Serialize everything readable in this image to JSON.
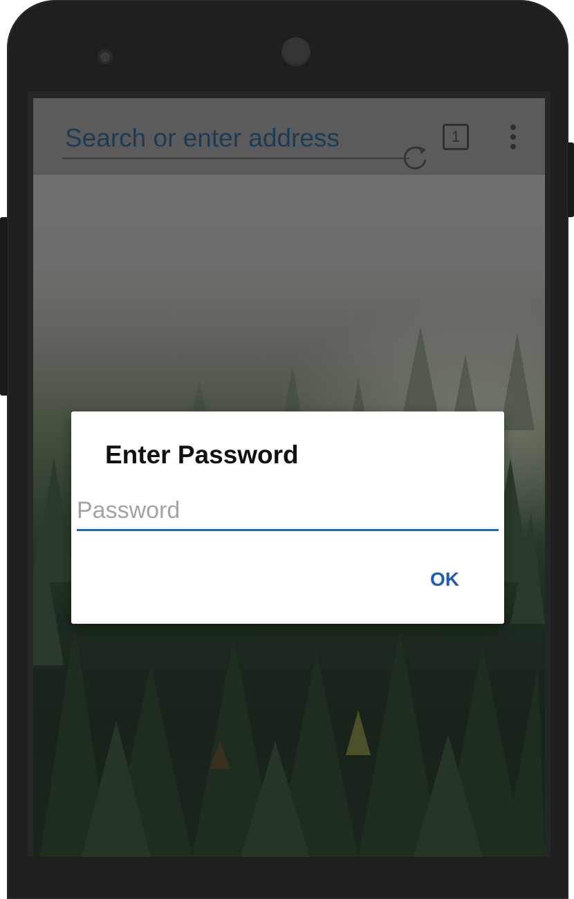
{
  "browser": {
    "address_placeholder": "Search or enter address",
    "tab_count": "1",
    "icons": {
      "reload": "reload-icon",
      "tabs": "tabs-counter-icon",
      "menu": "overflow-menu-icon"
    }
  },
  "dialog": {
    "title": "Enter Password",
    "password_placeholder": "Password",
    "ok_label": "OK"
  },
  "colors": {
    "accent": "#1a66b8",
    "ok_text": "#1f5bb5",
    "appbar": "#5b5b5b",
    "address_text": "#1d3b55"
  }
}
